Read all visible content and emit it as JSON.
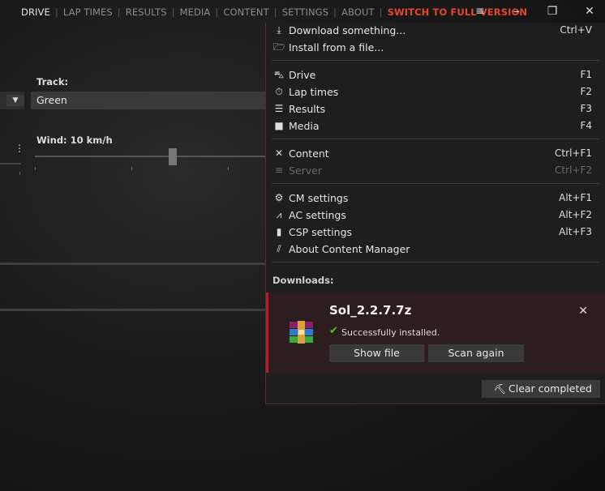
{
  "nav": {
    "items": [
      "DRIVE",
      "LAP TIMES",
      "RESULTS",
      "MEDIA",
      "CONTENT",
      "SETTINGS",
      "ABOUT"
    ],
    "full_version": "SWITCH TO FULL VERSION"
  },
  "window": {
    "menu_glyph": "≡",
    "maximize_glyph": "❐",
    "close_glyph": "✕"
  },
  "main": {
    "track_label": "Track:",
    "track_value": "Green",
    "wind_label": "Wind: 10 km/h"
  },
  "menu": {
    "items": [
      {
        "label": "Download something...",
        "shortcut": "Ctrl+V",
        "icon": "download-icon"
      },
      {
        "label": "Install from a file...",
        "shortcut": "",
        "icon": "folder-icon"
      },
      {
        "label": "Drive",
        "shortcut": "F1",
        "icon": "car-icon"
      },
      {
        "label": "Lap times",
        "shortcut": "F2",
        "icon": "stopwatch-icon"
      },
      {
        "label": "Results",
        "shortcut": "F3",
        "icon": "list-icon"
      },
      {
        "label": "Media",
        "shortcut": "F4",
        "icon": "camera-icon"
      },
      {
        "label": "Content",
        "shortcut": "Ctrl+F1",
        "icon": "tools-icon"
      },
      {
        "label": "Server",
        "shortcut": "Ctrl+F2",
        "icon": "server-icon",
        "disabled": true
      },
      {
        "label": "CM settings",
        "shortcut": "Alt+F1",
        "icon": "gear-icon"
      },
      {
        "label": "AC settings",
        "shortcut": "Alt+F2",
        "icon": "ac-logo-icon"
      },
      {
        "label": "CSP settings",
        "shortcut": "Alt+F3",
        "icon": "bookmark-icon"
      },
      {
        "label": "About Content Manager",
        "shortcut": "",
        "icon": "cm-logo-icon"
      }
    ],
    "downloads_header": "Downloads:",
    "download": {
      "title": "Sol_2.2.7.7z",
      "status": "Successfully installed.",
      "show_file": "Show file",
      "scan_again": "Scan again"
    },
    "clear_completed": "Clear completed"
  }
}
